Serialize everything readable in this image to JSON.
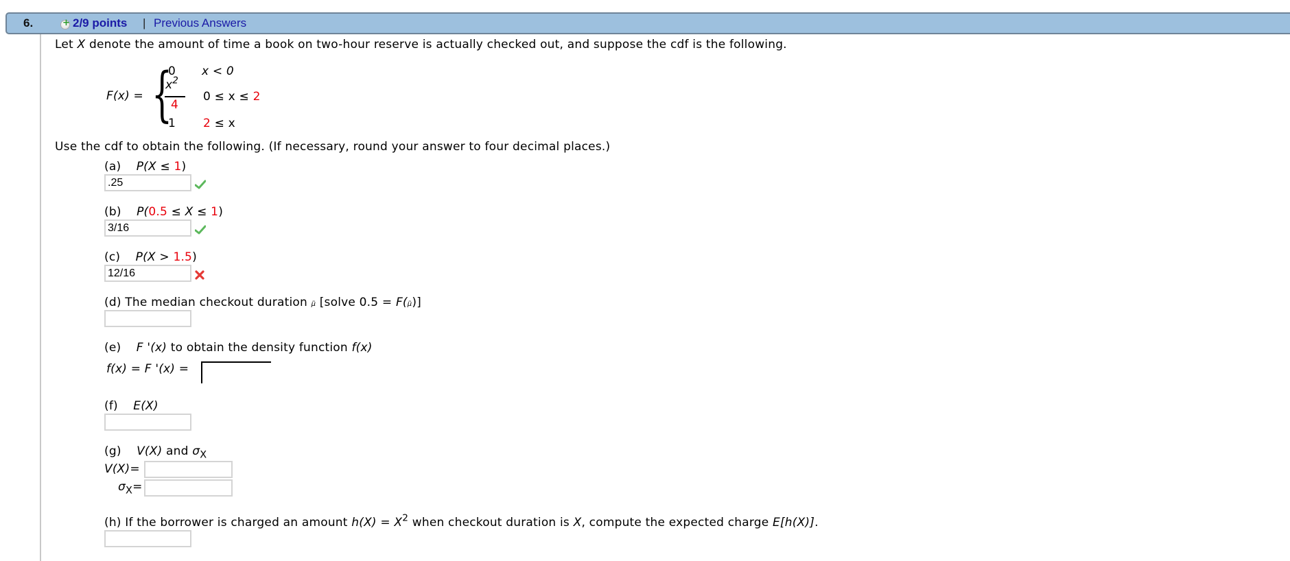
{
  "header": {
    "question_number": "6.",
    "points_icon": "plus-circle-icon",
    "points": "2/9 points",
    "separator": "|",
    "previous_answers_link": "Previous Answers"
  },
  "intro": {
    "before_var": "Let ",
    "var": "X",
    "after_var": " denote the amount of time a book on two-hour reserve is actually checked out, and suppose the cdf is the following."
  },
  "cdf": {
    "lhs": "F(x) =",
    "cases": [
      {
        "value": "0",
        "condition": "x < 0"
      },
      {
        "value_numerator": "x",
        "value_numerator_exp": "2",
        "value_denominator": "4",
        "condition_prefix": "0 ≤ x ≤ ",
        "condition_highlight": "2"
      },
      {
        "value": "1",
        "condition_highlight": "2",
        "condition_suffix": " ≤ x"
      }
    ],
    "highlight_color": "#e8000b"
  },
  "instruction": "Use the cdf to obtain the following. (If necessary, round your answer to four decimal places.)",
  "parts": {
    "a": {
      "label": "(a)",
      "expr_prefix": "P(X ≤ ",
      "expr_highlight": "1",
      "expr_suffix": ")",
      "answer": ".25",
      "status": "correct",
      "status_icon": "check-icon"
    },
    "b": {
      "label": "(b)",
      "expr_prefix": "P(",
      "expr_highlight1": "0.5",
      "expr_mid": " ≤ X ≤ ",
      "expr_highlight2": "1",
      "expr_suffix": ")",
      "answer": "3/16",
      "status": "correct",
      "status_icon": "check-icon"
    },
    "c": {
      "label": "(c)",
      "expr_prefix": "P(X > ",
      "expr_highlight": "1.5",
      "expr_suffix": ")",
      "answer": "12/16",
      "status": "incorrect",
      "status_icon": "x-icon"
    },
    "d": {
      "label": "(d) The median checkout duration ",
      "mu": "μ̃",
      "middle": " [solve 0.5 = ",
      "func": "F(",
      "mu2": "μ̃",
      "end": ")]",
      "answer": ""
    },
    "e": {
      "label": "(e)",
      "expr": "F '(x)",
      "text": " to obtain the density function ",
      "fx": "f(x)",
      "lhs": "f(x) = F '(x) =",
      "answer": ""
    },
    "f": {
      "label": "(f)",
      "expr": "E(X)",
      "answer": ""
    },
    "g": {
      "label": "(g)",
      "expr": "V(X)",
      "and": " and ",
      "sigma": "σ",
      "sigma_sub": "X",
      "vx_label": "V(X)",
      "eq": "=",
      "vx_answer": "",
      "sigma_answer": ""
    },
    "h": {
      "text1": "(h) If the borrower is charged an amount ",
      "hx": "h(X)",
      "eq": " = ",
      "X": "X",
      "exp": "2",
      "text2": " when checkout duration is ",
      "X2": "X",
      "text3": ", compute the expected charge ",
      "ehx": "E[h(X)]",
      "end": ".",
      "answer": ""
    }
  },
  "colors": {
    "header_bg": "#9dc0de",
    "header_border": "#6f8498",
    "link": "#1a1aa6",
    "correct": "#4caf50",
    "incorrect": "#e53935"
  }
}
